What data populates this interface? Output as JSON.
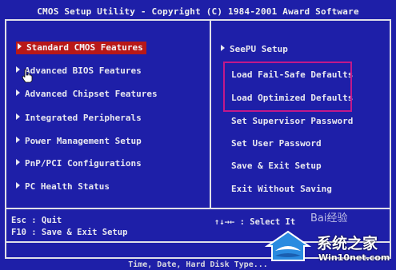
{
  "header": {
    "title": "CMOS Setup Utility - Copyright (C) 1984-2001 Award Software"
  },
  "left_menu": [
    {
      "label": "Standard CMOS Features"
    },
    {
      "label": "Advanced BIOS Features"
    },
    {
      "label": "Advanced Chipset Features"
    },
    {
      "label": "Integrated Peripherals"
    },
    {
      "label": "Power Management Setup"
    },
    {
      "label": "PnP/PCI Configurations"
    },
    {
      "label": "PC Health Status"
    }
  ],
  "right_menu": [
    {
      "label": "SeePU Setup"
    },
    {
      "label": "Load Fail-Safe Defaults"
    },
    {
      "label": "Load Optimized Defaults"
    },
    {
      "label": "Set Supervisor Password"
    },
    {
      "label": "Set User Password"
    },
    {
      "label": "Save & Exit Setup"
    },
    {
      "label": "Exit Without Saving"
    }
  ],
  "footer": {
    "esc_line": "Esc : Quit",
    "f10_line": "F10 : Save & Exit Setup",
    "nav_line": "↑↓→← : Select It"
  },
  "help_text": "Time, Date, Hard Disk Type...",
  "watermark": {
    "brand": "系统之家",
    "site": "Win10net.com",
    "baidu": "Bai经验"
  },
  "colors": {
    "background": "#1e1fa8",
    "selected": "#b81818",
    "annotation_box": "#c2188a"
  }
}
